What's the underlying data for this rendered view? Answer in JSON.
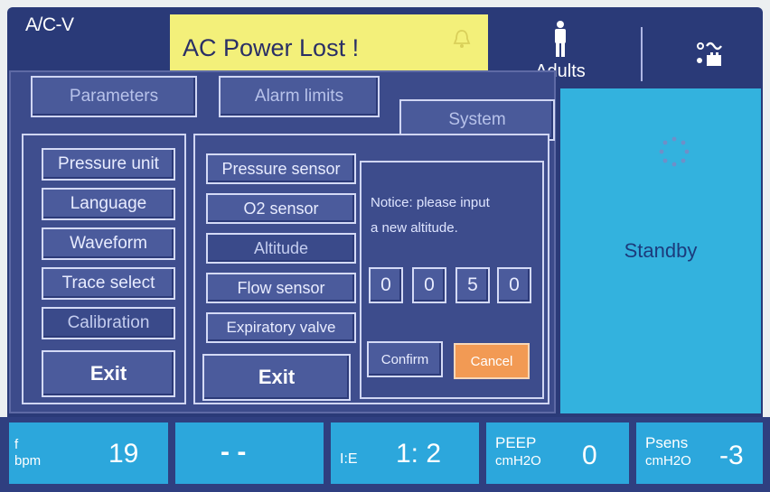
{
  "header": {
    "mode": "A/C-V",
    "alarm_message": "AC Power Lost !",
    "patient_type": "Adults"
  },
  "tabs": [
    {
      "label": "Parameters"
    },
    {
      "label": "Alarm limits"
    },
    {
      "label": "System"
    }
  ],
  "left_menu": {
    "items": [
      "Pressure unit",
      "Language",
      "Waveform",
      "Trace select",
      "Calibration"
    ],
    "exit_label": "Exit"
  },
  "calibration_menu": {
    "items": [
      "Pressure sensor",
      "O2 sensor",
      "Altitude",
      "Flow sensor",
      "Expiratory valve"
    ],
    "exit_label": "Exit"
  },
  "altitude_dialog": {
    "notice_line1": "Notice: please input",
    "notice_line2": "a new altitude.",
    "digits": [
      "0",
      "0",
      "5",
      "0"
    ],
    "confirm_label": "Confirm",
    "cancel_label": "Cancel"
  },
  "status_panel": {
    "state": "Standby"
  },
  "bottom_params": [
    {
      "label_line1": "f",
      "label_line2": "bpm",
      "value": "19"
    },
    {
      "label_line1": "",
      "label_line2": "",
      "value": "- -"
    },
    {
      "label_line1": "I:E",
      "label_line2": "",
      "value": "1: 2"
    },
    {
      "label_line1": "PEEP",
      "label_line2": "cmH2O",
      "value": "0"
    },
    {
      "label_line1": "Psens",
      "label_line2": "cmH2O",
      "value": "-3"
    }
  ],
  "colors": {
    "background": "#2a3a78",
    "alarm": "#f3f07a",
    "standby": "#33b2de",
    "cancel": "#f29a54",
    "param_cell": "#2ca7dc"
  },
  "icons": [
    "bell-icon",
    "person-icon",
    "ac-power-battery-icon",
    "spinner-icon"
  ]
}
